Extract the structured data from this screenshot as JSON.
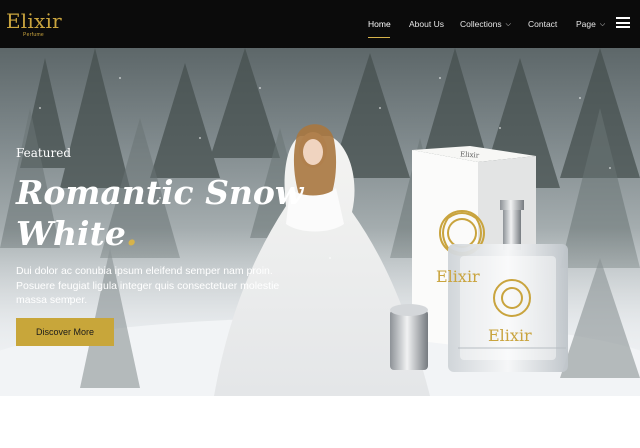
{
  "brand": {
    "name": "Elixir",
    "tagline": "Perfume"
  },
  "nav": {
    "items": [
      {
        "label": "Home",
        "active": true
      },
      {
        "label": "About Us"
      },
      {
        "label": "Collections",
        "dropdown": true
      },
      {
        "label": "Contact"
      },
      {
        "label": "Page",
        "dropdown": true
      }
    ]
  },
  "hero": {
    "eyebrow": "Featured",
    "title_line1": "Romantic Snow",
    "title_line2": "White",
    "title_dot": ".",
    "description": "Dui dolor ac conubia ipsum eleifend semper nam proin. Posuere feugiat ligula integer quis consectetuer molestie massa semper.",
    "cta_label": "Discover More",
    "product_box_label": "Elixir",
    "product_bottle_label": "Elixir"
  },
  "colors": {
    "accent": "#c8a63a",
    "navbar": "#0b0b0b"
  }
}
